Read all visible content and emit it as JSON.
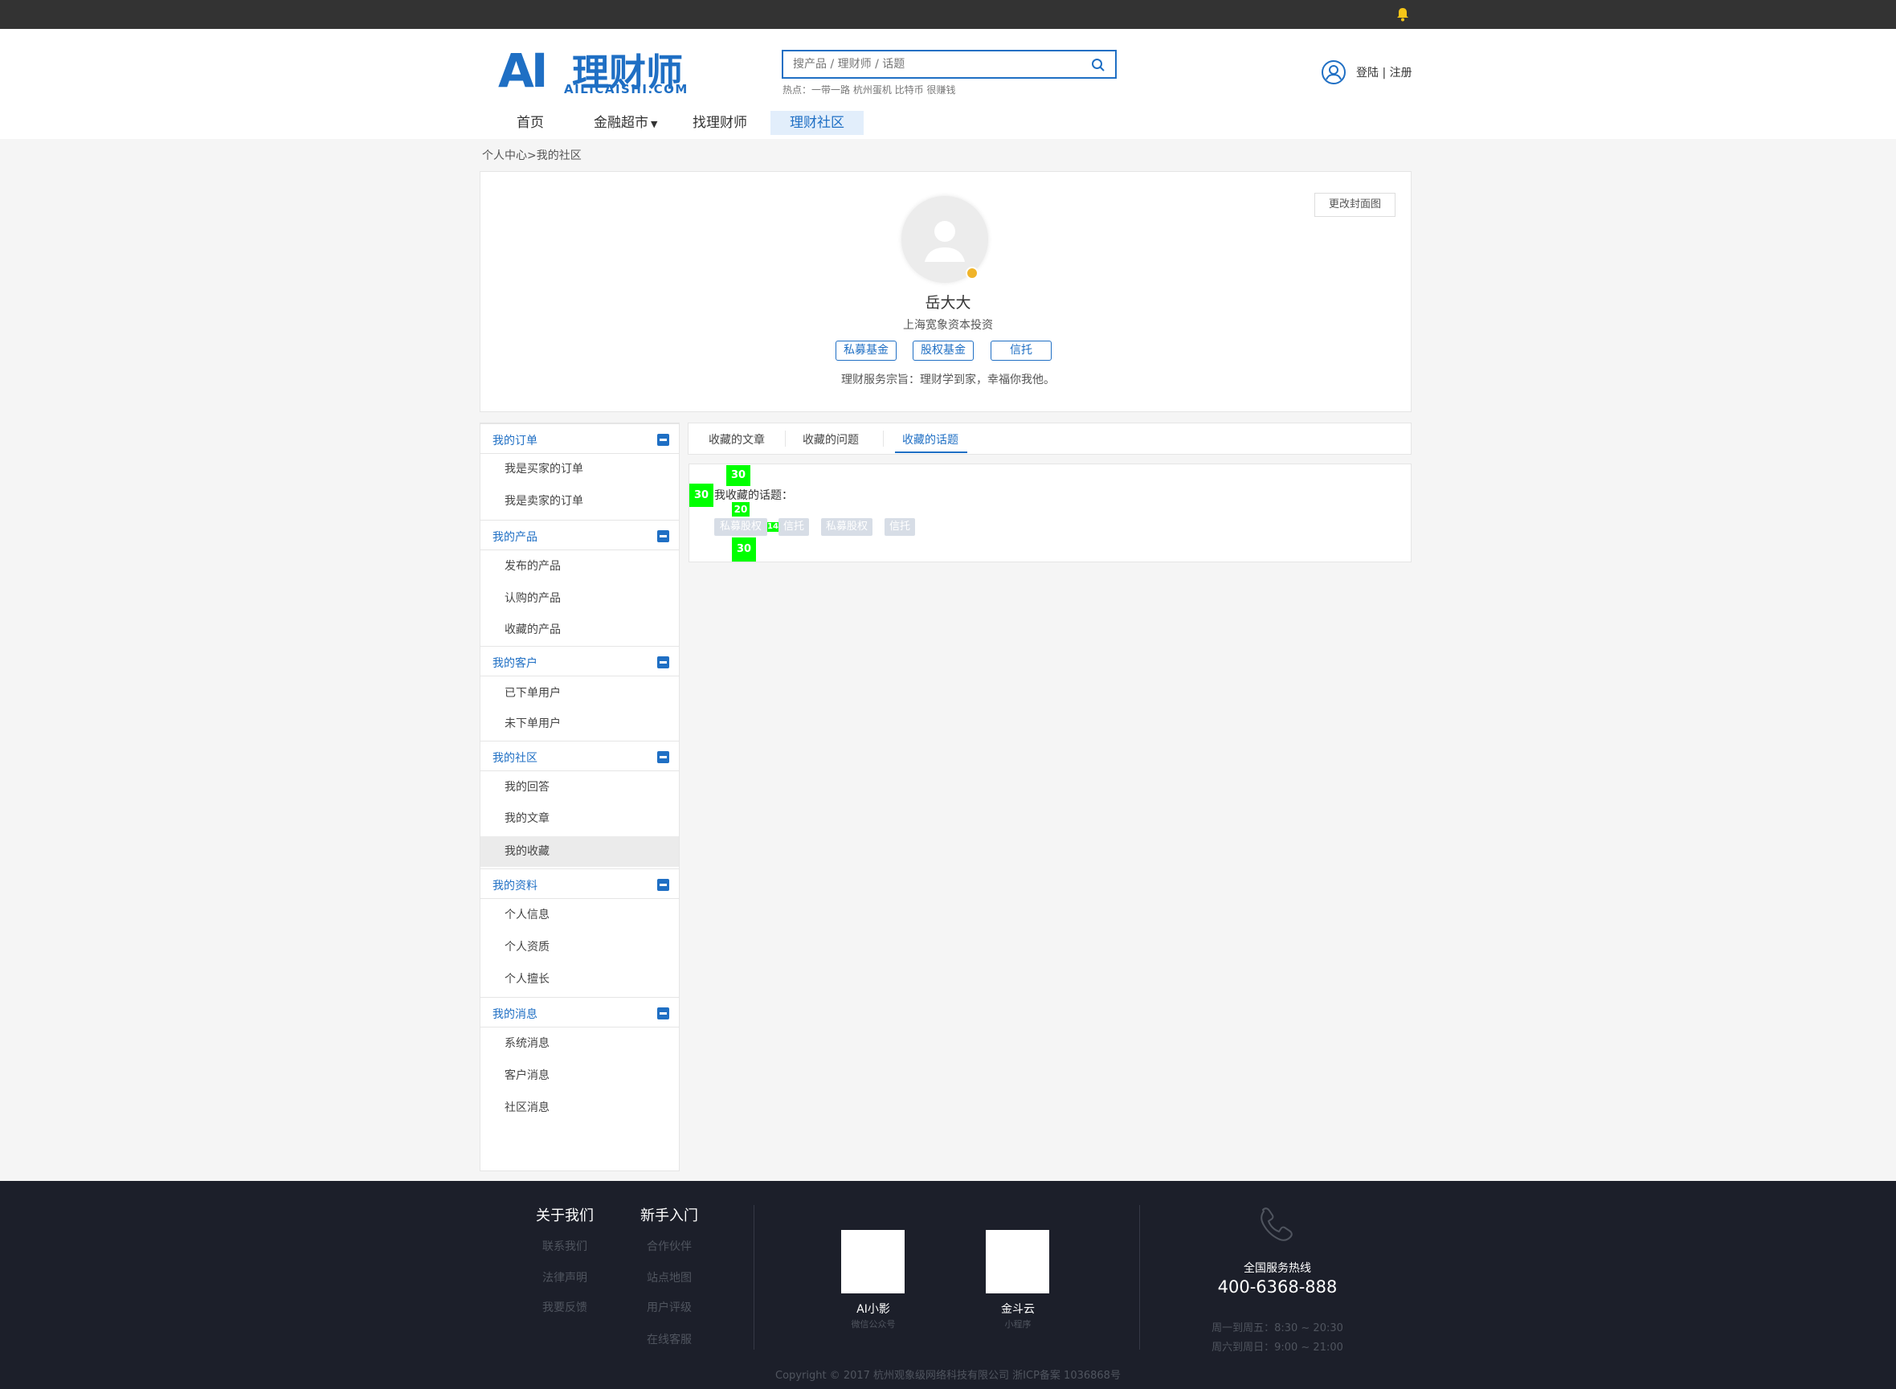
{
  "header": {
    "logo_ai": "AI",
    "logo_cn": "理财师",
    "logo_en": "AILICAISHI.COM",
    "search_placeholder": "搜产品 / 理财师 / 话题",
    "hot": "热点：一带一路 杭州蛋机 比特币 很赚钱",
    "login": "登陆 | 注册",
    "bell_icon": "bell-icon",
    "user_icon": "user-icon",
    "search_icon": "search-icon"
  },
  "nav": {
    "items": [
      "首页",
      "金融超市",
      "找理财师",
      "理财社区"
    ],
    "active": "理财社区"
  },
  "breadcrumb": "个人中心>我的社区",
  "profile": {
    "cover_button": "更改封面图",
    "name": "岳大大",
    "company": "上海宽象资本投资",
    "tags": [
      "私募基金",
      "股权基金",
      "信托"
    ],
    "motto": "理财服务宗旨：理财学到家，幸福你我他。"
  },
  "sidebar": [
    {
      "title": "我的订单",
      "items": [
        "我是买家的订单",
        "我是卖家的订单"
      ]
    },
    {
      "title": "我的产品",
      "items": [
        "发布的产品",
        "认购的产品",
        "收藏的产品"
      ]
    },
    {
      "title": "我的客户",
      "items": [
        "已下单用户",
        "未下单用户"
      ]
    },
    {
      "title": "我的社区",
      "items": [
        "我的回答",
        "我的文章",
        "我的收藏"
      ]
    },
    {
      "title": "我的资料",
      "items": [
        "个人信息",
        "个人资质",
        "个人擅长"
      ]
    },
    {
      "title": "我的消息",
      "items": [
        "系统消息",
        "客户消息",
        "社区消息"
      ]
    }
  ],
  "sidebar_selected": "我的收藏",
  "tabs": [
    "收藏的文章",
    "收藏的问题",
    "收藏的话题"
  ],
  "active_tab": "收藏的话题",
  "content": {
    "label": "我收藏的话题：",
    "topics": [
      "私募股权",
      "信托",
      "私募股权",
      "信托"
    ],
    "spacing_markers": [
      "30",
      "30",
      "20",
      "14",
      "30"
    ]
  },
  "footer": {
    "col1": {
      "title": "关于我们",
      "links": [
        "联系我们",
        "法律声明",
        "我要反馈"
      ]
    },
    "col2": {
      "title": "新手入门",
      "links": [
        "合作伙伴",
        "站点地图",
        "用户评级",
        "在线客服"
      ]
    },
    "qr1": {
      "name": "AI小影",
      "sub": "微信公众号"
    },
    "qr2": {
      "name": "金斗云",
      "sub": "小程序"
    },
    "hotline_label": "全国服务热线",
    "hotline": "400-6368-888",
    "hours1": "周一到周五：8:30 ~ 20:30",
    "hours2": "周六到周日：9:00 ~ 21:00",
    "copyright": "Copyright © 2017 杭州观象级网络科技有限公司 浙ICP备案 1036868号",
    "phone_icon": "phone-icon"
  },
  "colors": {
    "brand": "#1f6fc4",
    "marker": "#00ff00",
    "footer_bg": "#1c1f2a"
  }
}
